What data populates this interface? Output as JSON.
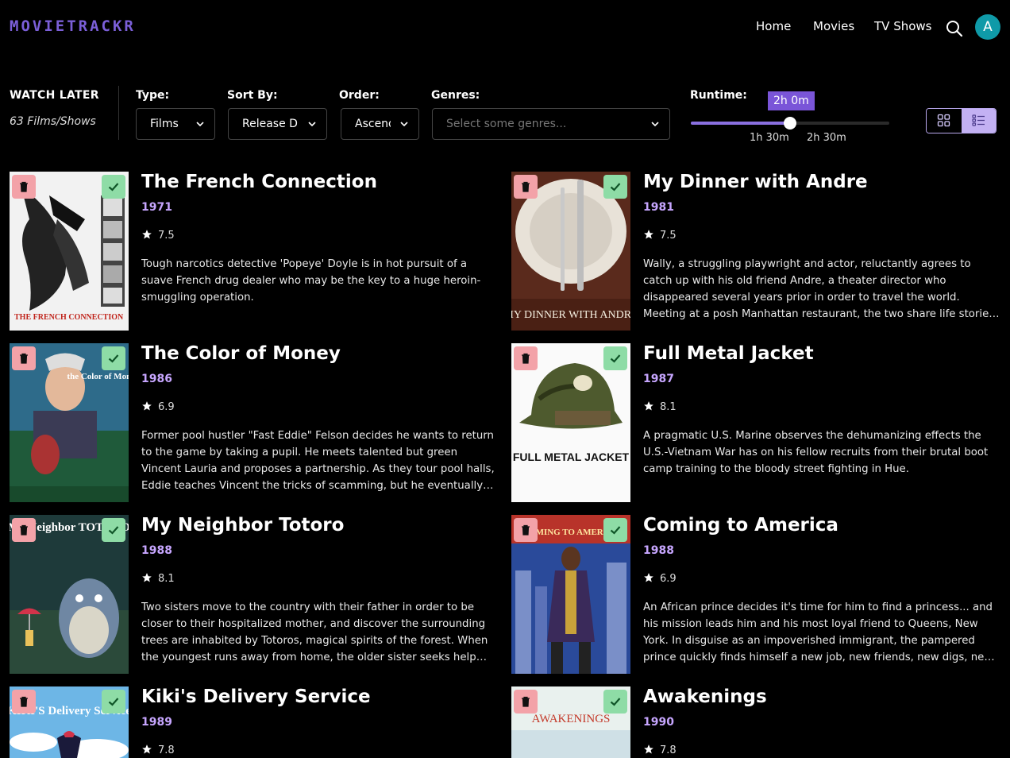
{
  "app": {
    "logo": "MOVIETRACKR",
    "accent": "#7b5fd8"
  },
  "nav": {
    "home": "Home",
    "movies": "Movies",
    "tv_shows": "TV Shows",
    "search_icon": "search-icon",
    "avatar_initial": "A",
    "avatar_color": "#0f9aa8"
  },
  "watch_later": {
    "title": "WATCH LATER",
    "count": "63 Films/Shows"
  },
  "filters": {
    "type_label": "Type:",
    "type_value": "Films",
    "sort_label": "Sort By:",
    "sort_value": "Release Date",
    "order_label": "Order:",
    "order_value": "Ascending",
    "genres_label": "Genres:",
    "genres_placeholder": "Select some genres...",
    "runtime_label": "Runtime:",
    "runtime_value": "2h 0m",
    "runtime_min_tick": "1h 30m",
    "runtime_max_tick": "2h 30m",
    "runtime_fraction": 0.5
  },
  "view": {
    "grid_icon": "grid-icon",
    "list_icon": "list-icon",
    "active": "list"
  },
  "movies": [
    {
      "title": "The French Connection",
      "year": "1971",
      "rating": "7.5",
      "description": "Tough narcotics detective 'Popeye' Doyle is in hot pursuit of a suave French drug dealer who may be the key to a huge heroin-smuggling operation.",
      "poster_text": "THE FRENCH CONNECTION"
    },
    {
      "title": "My Dinner with Andre",
      "year": "1981",
      "rating": "7.5",
      "description": "Wally, a struggling playwright and actor, reluctantly agrees to catch up with his old friend Andre, a theater director who disappeared several years prior in order to travel the world. Meeting at a posh Manhattan restaurant, the two share life stories, anecdotes and philosophical…",
      "poster_text": "MY DINNER WITH ANDRE"
    },
    {
      "title": "The Color of Money",
      "year": "1986",
      "rating": "6.9",
      "description": "Former pool hustler \"Fast Eddie\" Felson decides he wants to return to the game by taking a pupil. He meets talented but green Vincent Lauria and proposes a partnership. As they tour pool halls, Eddie teaches Vincent the tricks of scamming, but he eventually grows frustrated with…",
      "poster_text": "the Color of Money"
    },
    {
      "title": "Full Metal Jacket",
      "year": "1987",
      "rating": "8.1",
      "description": "A pragmatic U.S. Marine observes the dehumanizing effects the U.S.-Vietnam War has on his fellow recruits from their brutal boot camp training to the bloody street fighting in Hue.",
      "poster_text": "FULL METAL JACKET"
    },
    {
      "title": "My Neighbor Totoro",
      "year": "1988",
      "rating": "8.1",
      "description": "Two sisters move to the country with their father in order to be closer to their hospitalized mother, and discover the surrounding trees are inhabited by Totoros, magical spirits of the forest. When the youngest runs away from home, the older sister seeks help from the spirits to fin…",
      "poster_text": "My Neighbor TOTORO"
    },
    {
      "title": "Coming to America",
      "year": "1988",
      "rating": "6.9",
      "description": "An African prince decides it's time for him to find a princess... and his mission leads him and his most loyal friend to Queens, New York. In disguise as an impoverished immigrant, the pampered prince quickly finds himself a new job, new friends, new digs, new enemies and lots of…",
      "poster_text": "COMING TO AMERICA"
    },
    {
      "title": "Kiki's Delivery Service",
      "year": "1989",
      "rating": "7.8",
      "description": "",
      "poster_text": "KIKI'S Delivery Service"
    },
    {
      "title": "Awakenings",
      "year": "1990",
      "rating": "7.8",
      "description": "",
      "poster_text": "AWAKENINGS"
    }
  ]
}
